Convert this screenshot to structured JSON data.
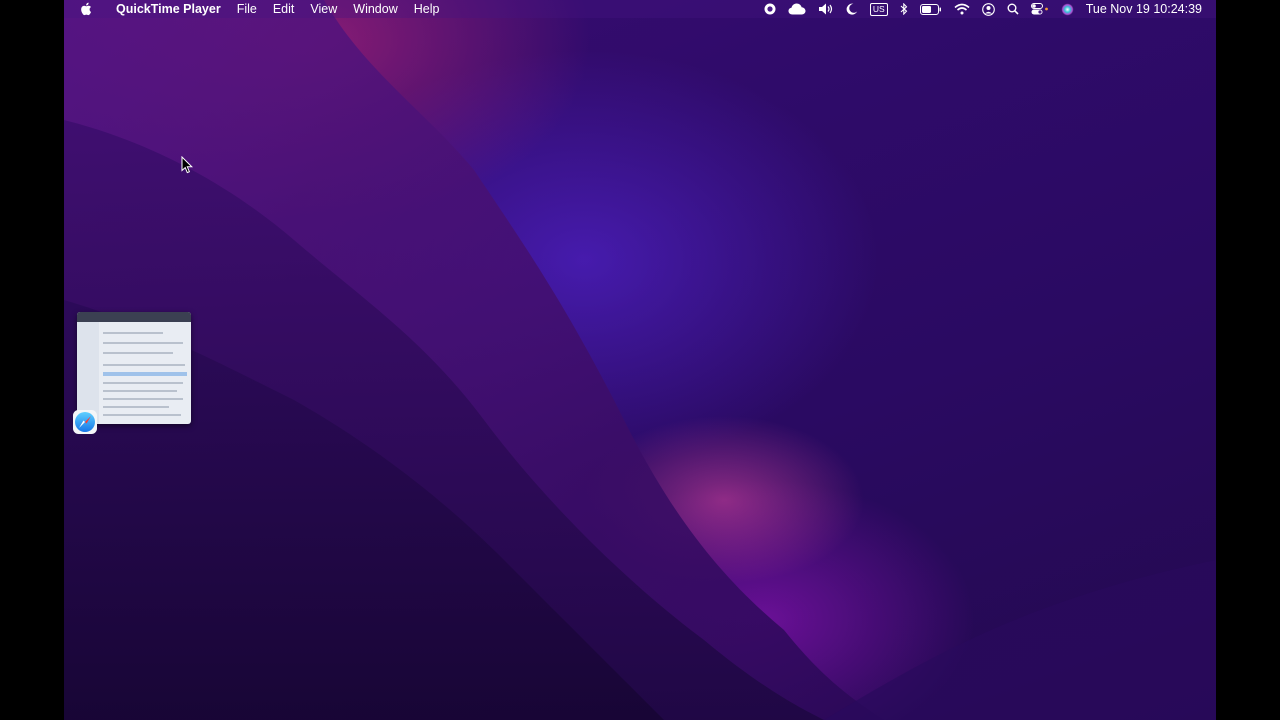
{
  "menubar": {
    "app_name": "QuickTime Player",
    "menus": [
      "File",
      "Edit",
      "View",
      "Window",
      "Help"
    ],
    "status_icons": [
      "screen-record-icon",
      "cloud-icon",
      "volume-icon",
      "moon-icon",
      "keyboard-input-icon",
      "bluetooth-icon",
      "battery-icon",
      "wifi-icon",
      "user-icon",
      "search-icon",
      "control-center-icon",
      "siri-icon"
    ],
    "input_source": "US",
    "clock": "Tue Nov 19  10:24:39"
  },
  "desktop": {
    "window_thumbnail": {
      "app_icon": "safari-icon"
    }
  },
  "colors": {
    "menubar_text": "#ffffff",
    "wallpaper_base": "#2f0b6a",
    "wallpaper_accent": "#c8287a"
  }
}
